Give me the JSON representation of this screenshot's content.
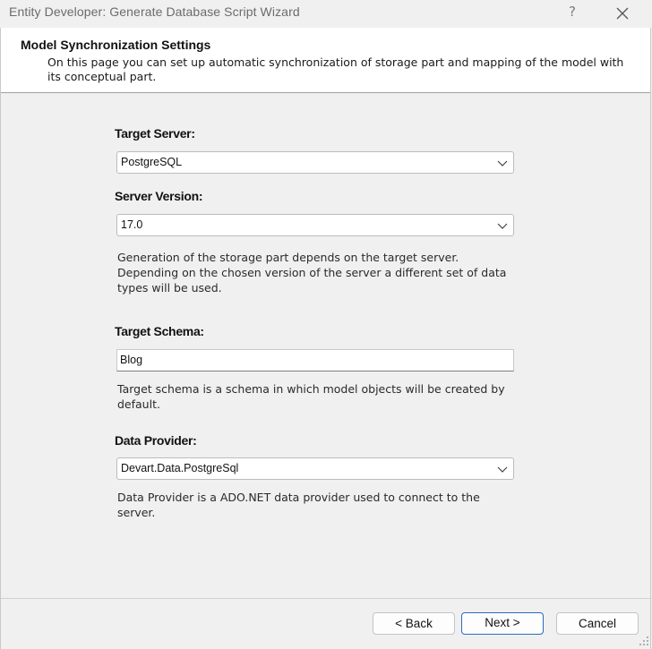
{
  "window": {
    "title": "Entity Developer: Generate Database Script Wizard",
    "help_glyph": "?",
    "close_icon": "close-icon"
  },
  "header": {
    "title": "Model Synchronization Settings",
    "description": "On this page you can set up automatic synchronization of storage part and mapping of the model with its conceptual part."
  },
  "form": {
    "target_server": {
      "label": "Target Server:",
      "value": "PostgreSQL"
    },
    "server_version": {
      "label": "Server Version:",
      "value": "17.0",
      "help": "Generation of the storage part depends on the target server. Depending on the chosen version of the server a different set of data types will be used."
    },
    "target_schema": {
      "label": "Target Schema:",
      "value": "Blog",
      "help": "Target schema is a schema in which model objects will be created by default."
    },
    "data_provider": {
      "label": "Data Provider:",
      "value": "Devart.Data.PostgreSql",
      "help": "Data Provider is a ADO.NET data provider used to connect to the server."
    }
  },
  "footer": {
    "back_label": "< Back",
    "next_label": "Next >",
    "cancel_label": "Cancel"
  }
}
